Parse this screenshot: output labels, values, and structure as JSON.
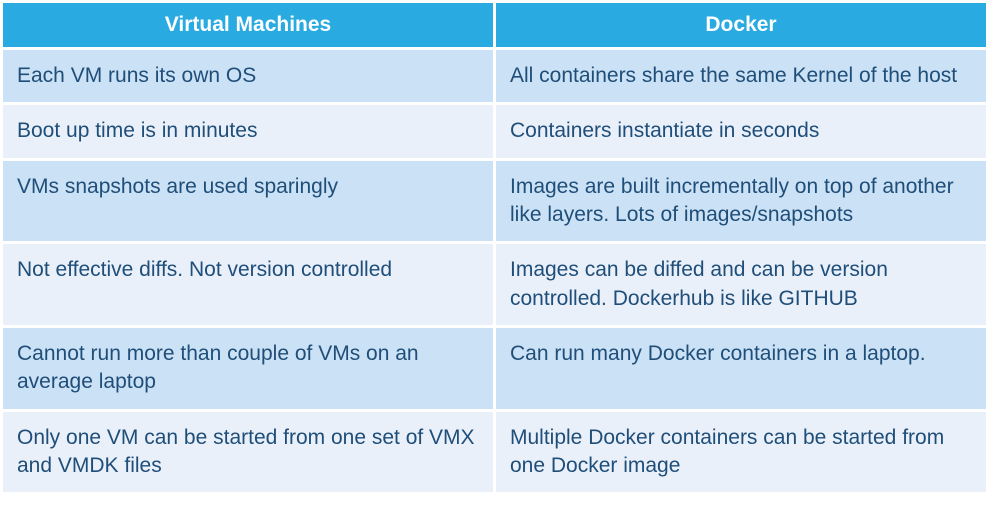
{
  "table": {
    "headers": {
      "col1": "Virtual Machines",
      "col2": "Docker"
    },
    "rows": [
      {
        "vm": "Each VM runs its own OS",
        "docker": "All containers share the same Kernel of the host"
      },
      {
        "vm": "Boot up time is in minutes",
        "docker": "Containers instantiate in seconds"
      },
      {
        "vm": "VMs snapshots are used sparingly",
        "docker": "Images are built incrementally on top of another like layers. Lots of images/snapshots"
      },
      {
        "vm": "Not effective diffs. Not version controlled",
        "docker": "Images can be diffed and can be version controlled. Dockerhub is like GITHUB"
      },
      {
        "vm": "Cannot run more than couple of VMs on an average laptop",
        "docker": "Can run many Docker containers in a laptop."
      },
      {
        "vm": "Only one VM can be started from one set of VMX and VMDK files",
        "docker": "Multiple Docker containers can be started from one Docker image"
      }
    ]
  }
}
